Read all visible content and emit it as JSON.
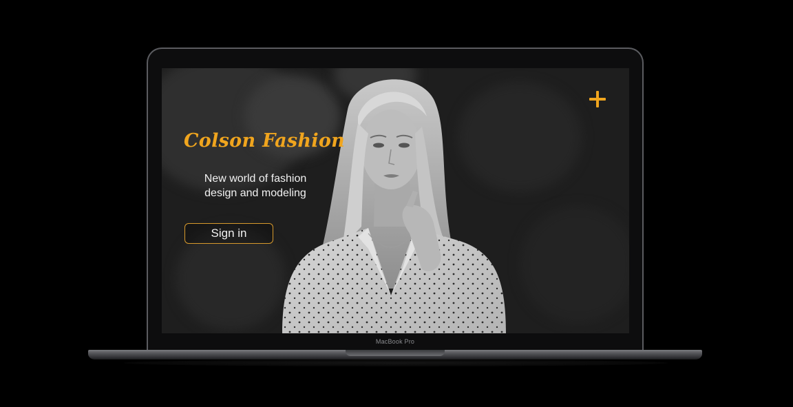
{
  "device": {
    "label": "MacBook Pro"
  },
  "hero": {
    "brand": "Colson Fashion",
    "tagline": "New world of fashion design and modeling",
    "signin_label": "Sign in",
    "add_icon": "plus-icon"
  },
  "colors": {
    "accent": "#f0a51e",
    "text": "#f2f2f2",
    "background": "#1e1e1e"
  }
}
